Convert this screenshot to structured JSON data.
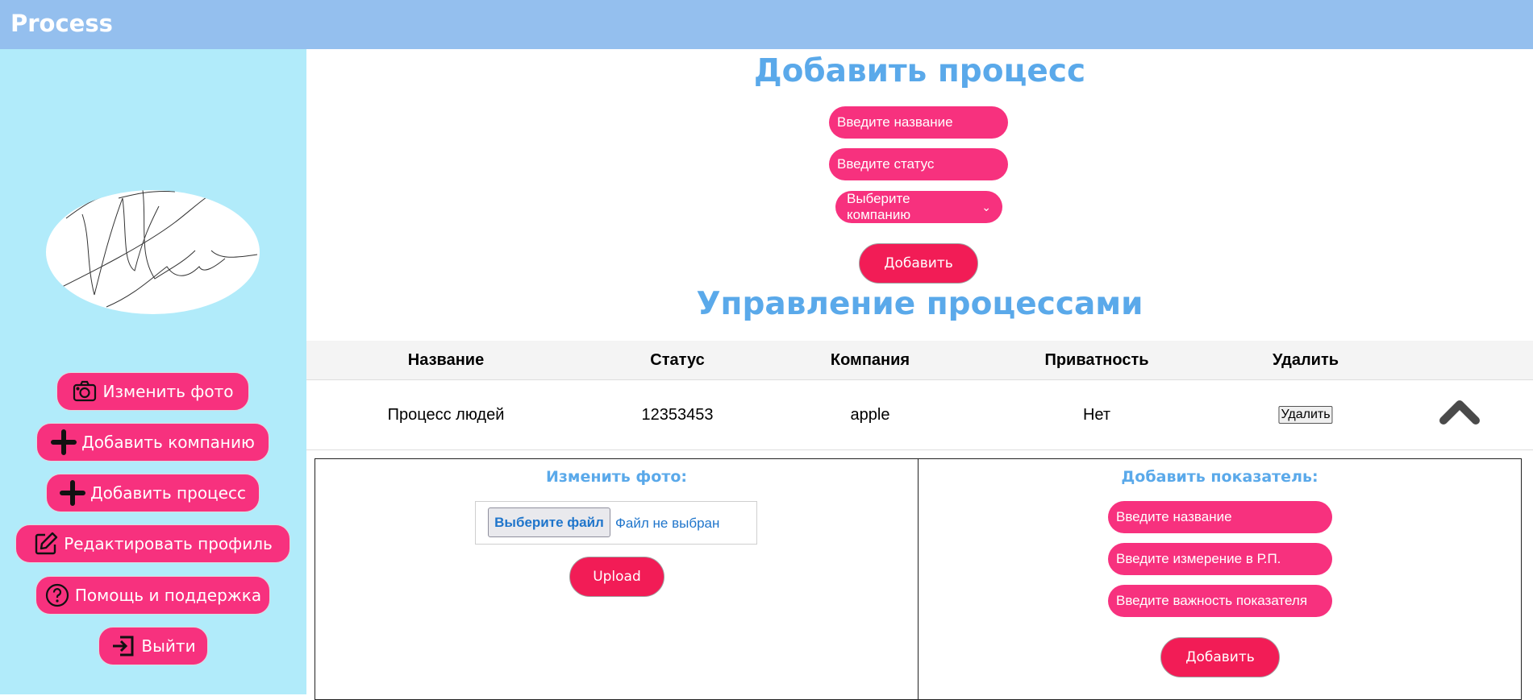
{
  "app": {
    "title": "Process"
  },
  "sidebar": {
    "items": [
      {
        "label": "Изменить фото",
        "icon": "camera-icon"
      },
      {
        "label": "Добавить компанию",
        "icon": "plus-icon"
      },
      {
        "label": "Добавить процесс",
        "icon": "plus-icon"
      },
      {
        "label": "Редактировать профиль",
        "icon": "edit-icon"
      },
      {
        "label": "Помощь и поддержка",
        "icon": "help-icon"
      },
      {
        "label": "Выйти",
        "icon": "logout-icon"
      }
    ]
  },
  "add_process": {
    "title": "Добавить процесс",
    "name_placeholder": "Введите название",
    "status_placeholder": "Введите статус",
    "company_select": "Выберите компанию",
    "submit_label": "Добавить"
  },
  "manage": {
    "title": "Управление процессами",
    "columns": [
      "Название",
      "Статус",
      "Компания",
      "Приватность",
      "Удалить"
    ],
    "rows": [
      {
        "name": "Процесс людей",
        "status": "12353453",
        "company": "apple",
        "privacy": "Нет",
        "delete_label": "Удалить"
      }
    ]
  },
  "photo_panel": {
    "title": "Изменить фото:",
    "file_button": "Выберите файл",
    "file_status": "Файл не выбран",
    "upload_label": "Upload"
  },
  "indicator_panel": {
    "title": "Добавить показатель:",
    "name_placeholder": "Введите название",
    "measure_placeholder": "Введите измерение в Р.П.",
    "importance_placeholder": "Введите важность показателя",
    "submit_label": "Добавить"
  },
  "colors": {
    "topbar": "#94bfee",
    "sidebar": "#b1ebfa",
    "pink": "#f7317e",
    "red_button": "#f21c56",
    "title_blue": "#5aa9ea"
  }
}
